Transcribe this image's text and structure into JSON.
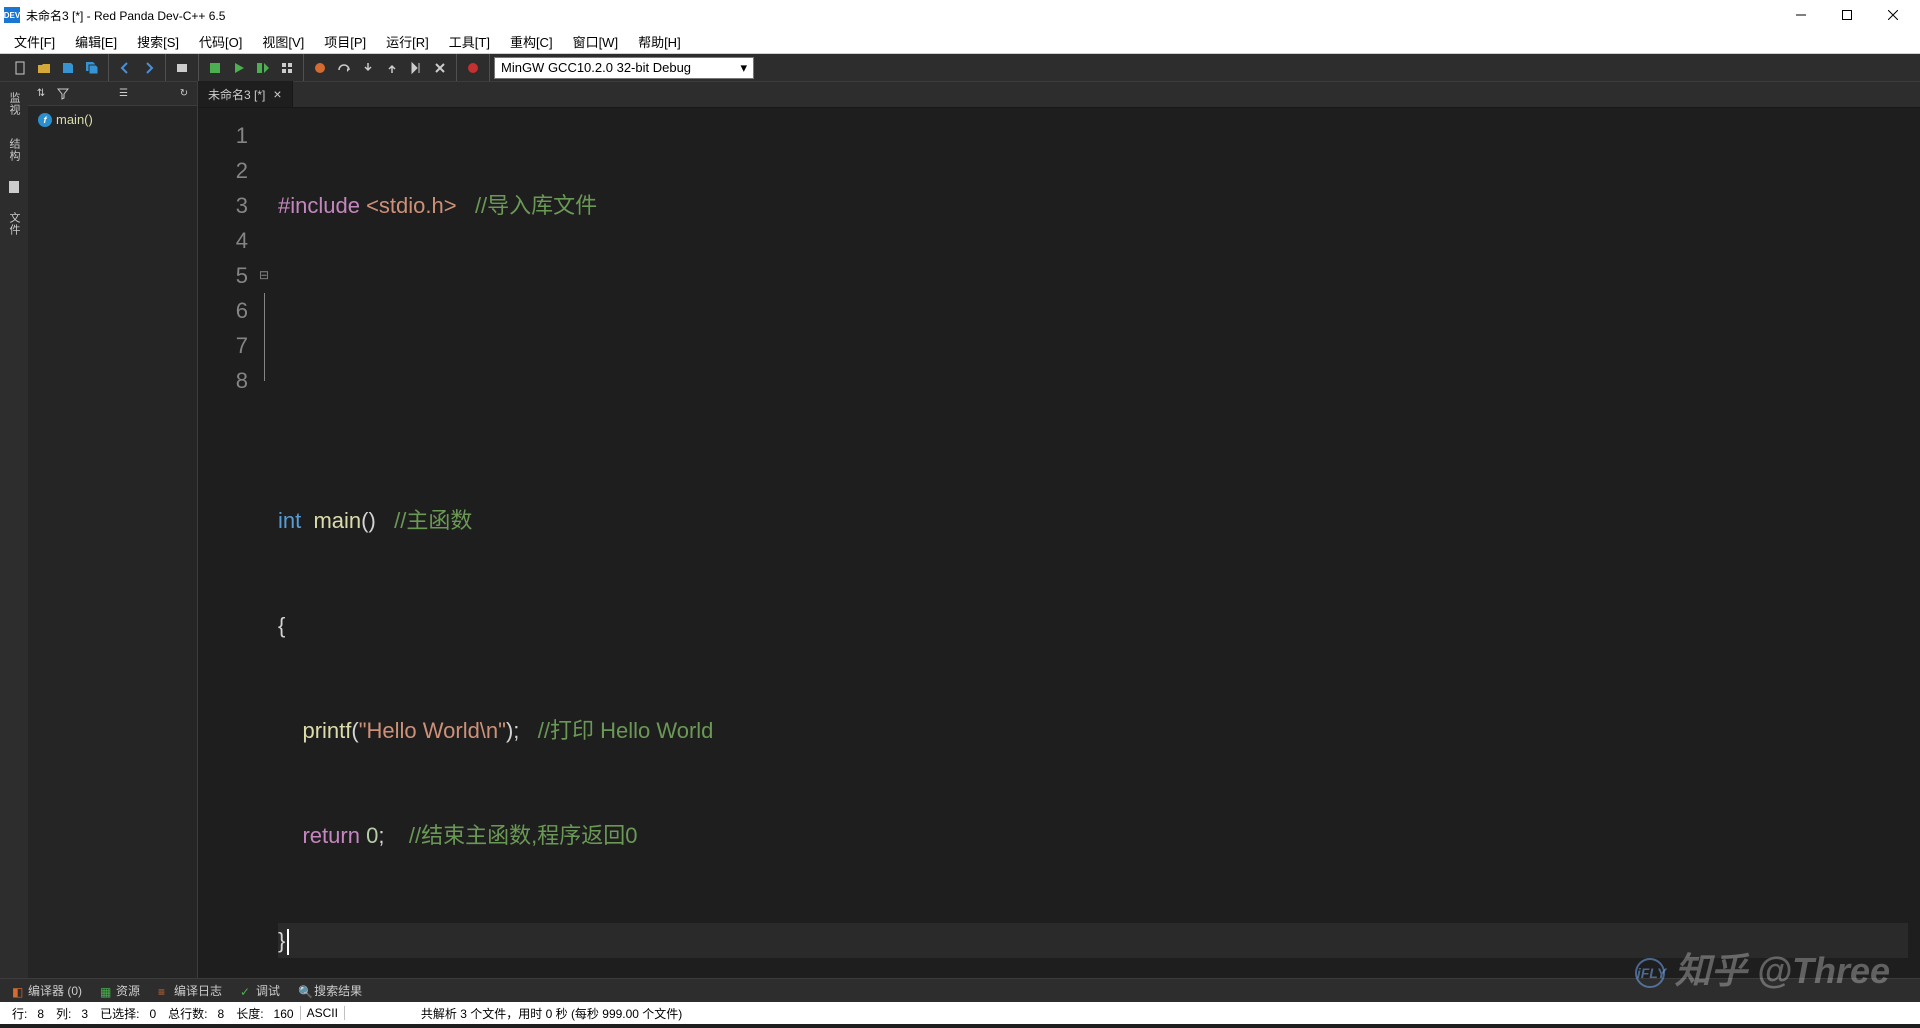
{
  "window": {
    "title": "未命名3 [*] - Red Panda Dev-C++ 6.5",
    "app_icon_text": "DEV"
  },
  "menubar": [
    "文件[F]",
    "编辑[E]",
    "搜索[S]",
    "代码[O]",
    "视图[V]",
    "项目[P]",
    "运行[R]",
    "工具[T]",
    "重构[C]",
    "窗口[W]",
    "帮助[H]"
  ],
  "toolbar": {
    "compiler_select": "MinGW GCC10.2.0 32-bit Debug"
  },
  "left_tabs": [
    "监视",
    "结构",
    "文件"
  ],
  "sidebar": {
    "tree": [
      {
        "icon": "f",
        "label": "main()"
      }
    ]
  },
  "tabs": [
    {
      "label": "未命名3 [*]"
    }
  ],
  "code": {
    "lines": [
      1,
      2,
      3,
      4,
      5,
      6,
      7,
      8
    ],
    "l1": {
      "include": "#include",
      "header": "<stdio.h>",
      "comment": "//导入库文件"
    },
    "l4": {
      "type": "int",
      "func": "main",
      "paren": "()",
      "comment": "//主函数"
    },
    "l5": {
      "brace": "{"
    },
    "l6": {
      "func": "printf",
      "open": "(",
      "str": "\"Hello World\\n\"",
      "close": ");",
      "comment": "//打印 Hello World"
    },
    "l7": {
      "kw": "return",
      "num": "0",
      "semi": ";",
      "comment": "//结束主函数,程序返回0"
    },
    "l8": {
      "brace": "}"
    }
  },
  "bottom_tabs": [
    {
      "label": "编译器 (0)"
    },
    {
      "label": "资源"
    },
    {
      "label": "编译日志"
    },
    {
      "label": "调试"
    },
    {
      "label": "搜索结果"
    }
  ],
  "statusbar": {
    "row_label": "行:",
    "row": "8",
    "col_label": "列:",
    "col": "3",
    "sel_label": "已选择:",
    "sel": "0",
    "total_label": "总行数:",
    "total": "8",
    "len_label": "长度:",
    "len": "160",
    "encoding": "ASCII",
    "parse": "共解析 3 个文件，用时 0 秒 (每秒 999.00 个文件)"
  },
  "watermark": "知乎 @Three"
}
